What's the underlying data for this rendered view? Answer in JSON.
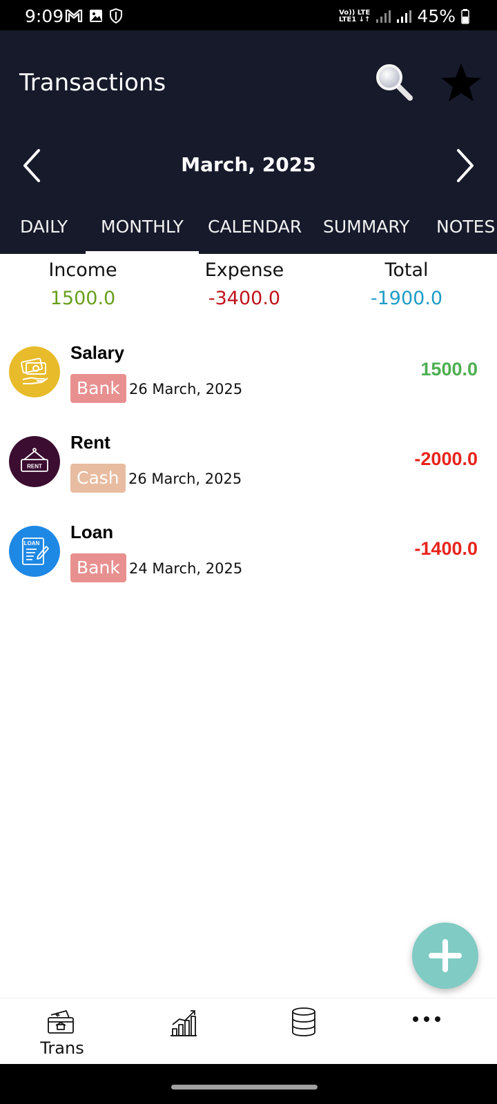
{
  "status_bar": {
    "time": "9:09",
    "network_top": "Vo)) LTE",
    "network_bottom": "LTE1 ↓↑",
    "battery": "45%"
  },
  "header": {
    "title": "Transactions",
    "month": "March, 2025",
    "search_icon": "search-icon",
    "favorite_icon": "star-icon"
  },
  "tabs": [
    {
      "label": "DAILY",
      "active": false
    },
    {
      "label": "MONTHLY",
      "active": true
    },
    {
      "label": "CALENDAR",
      "active": false
    },
    {
      "label": "SUMMARY",
      "active": false
    },
    {
      "label": "NOTES",
      "active": false
    }
  ],
  "summary": {
    "income_label": "Income",
    "income_value": "1500.0",
    "expense_label": "Expense",
    "expense_value": "-3400.0",
    "total_label": "Total",
    "total_value": "-1900.0",
    "colors": {
      "income": "#689f1c",
      "expense": "#c0131b",
      "total": "#1d9cc6"
    }
  },
  "transactions": [
    {
      "title": "Salary",
      "account": "Bank",
      "date": "26 March, 2025",
      "amount": "1500.0",
      "icon": "salary-icon",
      "avatar_color": "#e8bb2a",
      "badge_color": "#e89090",
      "amount_color": "#4caf50"
    },
    {
      "title": "Rent",
      "account": "Cash",
      "date": "26 March, 2025",
      "amount": "-2000.0",
      "icon": "rent-sign-icon",
      "avatar_color": "#3b0d30",
      "badge_color": "#e8bca0",
      "amount_color": "#e8231c"
    },
    {
      "title": "Loan",
      "account": "Bank",
      "date": "24 March, 2025",
      "amount": "-1400.0",
      "icon": "loan-document-icon",
      "avatar_color": "#1e88e5",
      "badge_color": "#e89090",
      "amount_color": "#e8231c"
    }
  ],
  "fab": {
    "icon": "plus-icon",
    "color": "#80cbc4"
  },
  "bottom_nav": [
    {
      "label": "Trans",
      "icon": "transactions-icon"
    },
    {
      "label": "",
      "icon": "stats-chart-icon"
    },
    {
      "label": "",
      "icon": "database-icon"
    },
    {
      "label": "",
      "icon": "more-icon"
    }
  ]
}
